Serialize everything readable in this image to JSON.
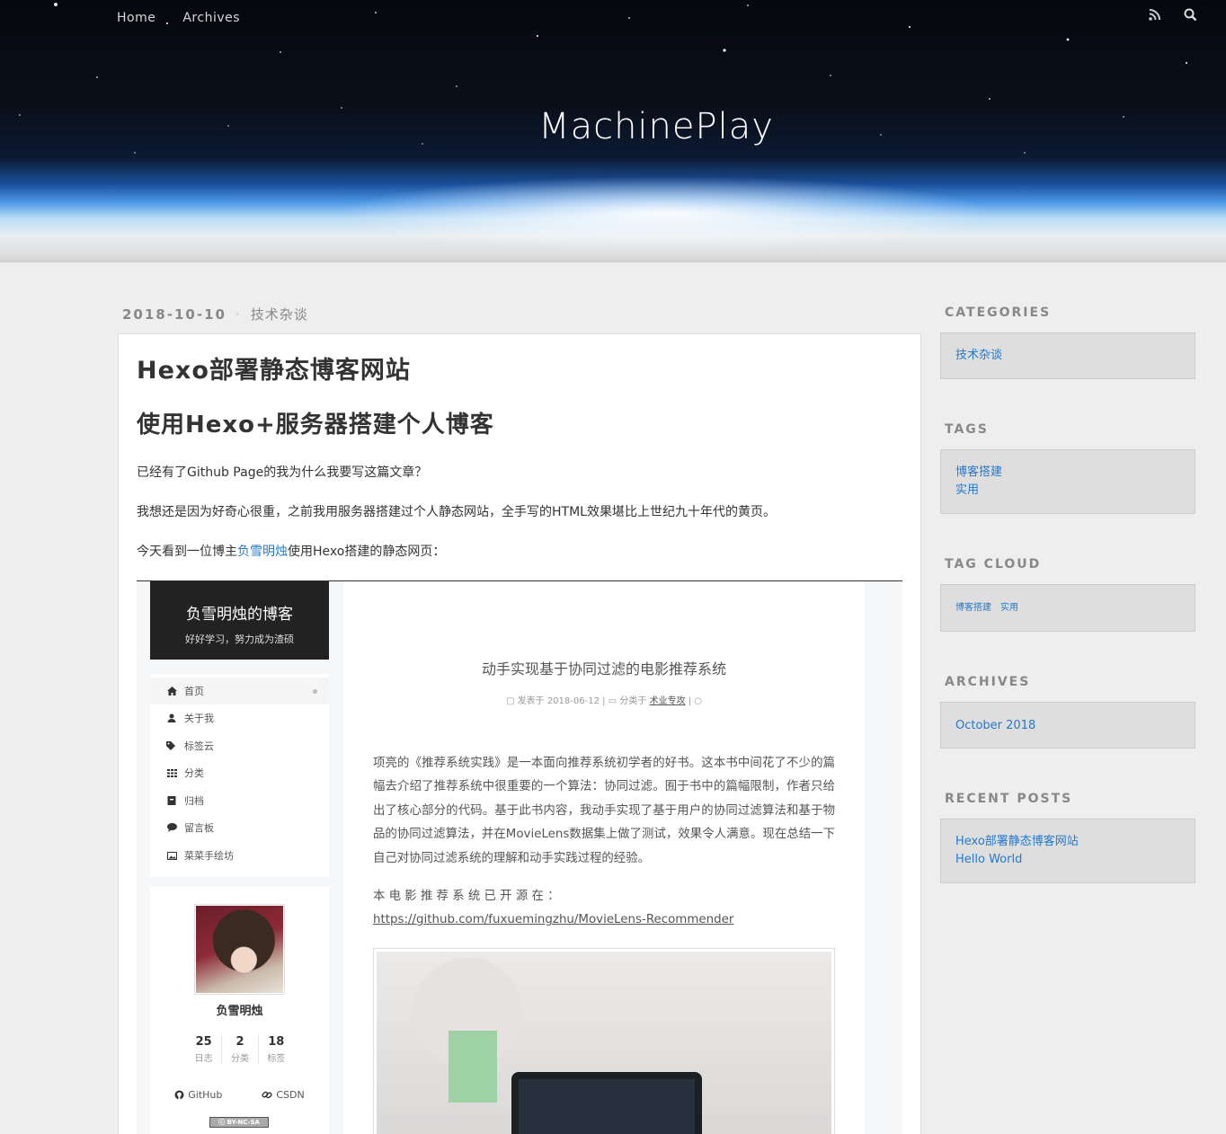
{
  "nav": {
    "home": "Home",
    "archives": "Archives"
  },
  "site_title": "MachinePlay",
  "post": {
    "date": "2018-10-10",
    "category": "技术杂谈",
    "title": "Hexo部署静态博客网站",
    "subtitle": "使用Hexo+服务器搭建个人博客",
    "p1": "已经有了Github Page的我为什么我要写这篇文章？",
    "p2": "我想还是因为好奇心很重，之前我用服务器搭建过个人静态网站，全手写的HTML效果堪比上世纪九十年代的黄页。",
    "p3_before": "今天看到一位博主",
    "p3_link": "负雪明烛",
    "p3_after": "使用Hexo搭建的静态网页："
  },
  "screenshot": {
    "brand_title": "负雪明烛的博客",
    "brand_sub": "好好学习，努力成为渣硕",
    "menu": [
      "首页",
      "关于我",
      "标签云",
      "分类",
      "归档",
      "留言板",
      "菜菜手绘坊"
    ],
    "profile_name": "负雪明烛",
    "stats": [
      {
        "n": "25",
        "l": "日志"
      },
      {
        "n": "2",
        "l": "分类"
      },
      {
        "n": "18",
        "l": "标签"
      }
    ],
    "link_github": "GitHub",
    "link_csdn": "CSDN",
    "cc": "BY-NC-SA",
    "article_title": "动手实现基于协同过滤的电影推荐系统",
    "meta_published": "发表于 2018-06-12",
    "meta_category_prefix": "分类于",
    "meta_category": "术业专攻",
    "body": "项亮的《推荐系统实践》是一本面向推荐系统初学者的好书。这本书中间花了不少的篇幅去介绍了推荐系统中很重要的一个算法：协同过滤。囿于书中的篇幅限制，作者只给出了核心部分的代码。基于此书内容，我动手实现了基于用户的协同过滤算法和基于物品的协同过滤算法，并在MovieLens数据集上做了测试，效果令人满意。现在总结一下自己对协同过滤系统的理解和动手实践过程的经验。",
    "source_prefix": "本 电 影 推 荐 系 统 已 开 源 在 ：",
    "source_link": "https://github.com/fuxuemingzhu/MovieLens-Recommender"
  },
  "sidebar": {
    "categories_title": "CATEGORIES",
    "categories": [
      "技术杂谈"
    ],
    "tags_title": "TAGS",
    "tags": [
      "博客搭建",
      "实用"
    ],
    "tagcloud_title": "TAG CLOUD",
    "tagcloud": [
      "博客搭建",
      "实用"
    ],
    "archives_title": "ARCHIVES",
    "archives": [
      "October 2018"
    ],
    "recent_title": "RECENT POSTS",
    "recent": [
      "Hexo部署静态博客网站",
      "Hello World"
    ]
  },
  "colors": {
    "link": "#2479cc",
    "background": "#eeeeee",
    "header_sky": "#05080d"
  }
}
